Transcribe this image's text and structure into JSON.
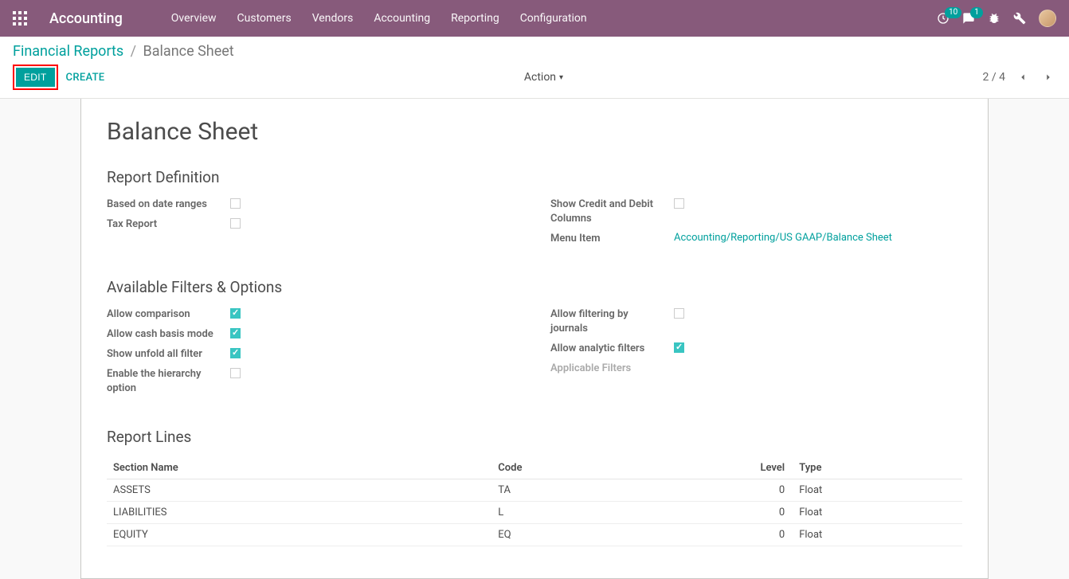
{
  "header": {
    "brand": "Accounting",
    "menu": [
      "Overview",
      "Customers",
      "Vendors",
      "Accounting",
      "Reporting",
      "Configuration"
    ],
    "clock_badge": "10",
    "chat_badge": "1"
  },
  "breadcrumb": {
    "parent": "Financial Reports",
    "current": "Balance Sheet"
  },
  "buttons": {
    "edit": "EDIT",
    "create": "CREATE",
    "action": "Action"
  },
  "pager": {
    "current": "2",
    "total": "4"
  },
  "sheet": {
    "title": "Balance Sheet",
    "sections": {
      "definition": "Report Definition",
      "filters": "Available Filters & Options",
      "lines": "Report Lines"
    },
    "def_left": {
      "date_ranges": {
        "label": "Based on date ranges",
        "checked": false
      },
      "tax_report": {
        "label": "Tax Report",
        "checked": false
      }
    },
    "def_right": {
      "credit_debit": {
        "label": "Show Credit and Debit Columns",
        "checked": false
      },
      "menu_item_label": "Menu Item",
      "menu_path": [
        "Accounting",
        "Reporting",
        "US GAAP",
        "Balance Sheet"
      ]
    },
    "filt_left": {
      "comparison": {
        "label": "Allow comparison",
        "checked": true
      },
      "cash_basis": {
        "label": "Allow cash basis mode",
        "checked": true
      },
      "unfold_all": {
        "label": "Show unfold all filter",
        "checked": true
      },
      "hierarchy": {
        "label": "Enable the hierarchy option",
        "checked": false
      }
    },
    "filt_right": {
      "journals": {
        "label": "Allow filtering by journals",
        "checked": false
      },
      "analytic": {
        "label": "Allow analytic filters",
        "checked": true
      },
      "applicable": {
        "label": "Applicable Filters"
      }
    },
    "lines_cols": {
      "name": "Section Name",
      "code": "Code",
      "level": "Level",
      "type": "Type"
    },
    "lines": [
      {
        "name": "ASSETS",
        "code": "TA",
        "level": "0",
        "type": "Float"
      },
      {
        "name": "LIABILITIES",
        "code": "L",
        "level": "0",
        "type": "Float"
      },
      {
        "name": "EQUITY",
        "code": "EQ",
        "level": "0",
        "type": "Float"
      }
    ]
  }
}
